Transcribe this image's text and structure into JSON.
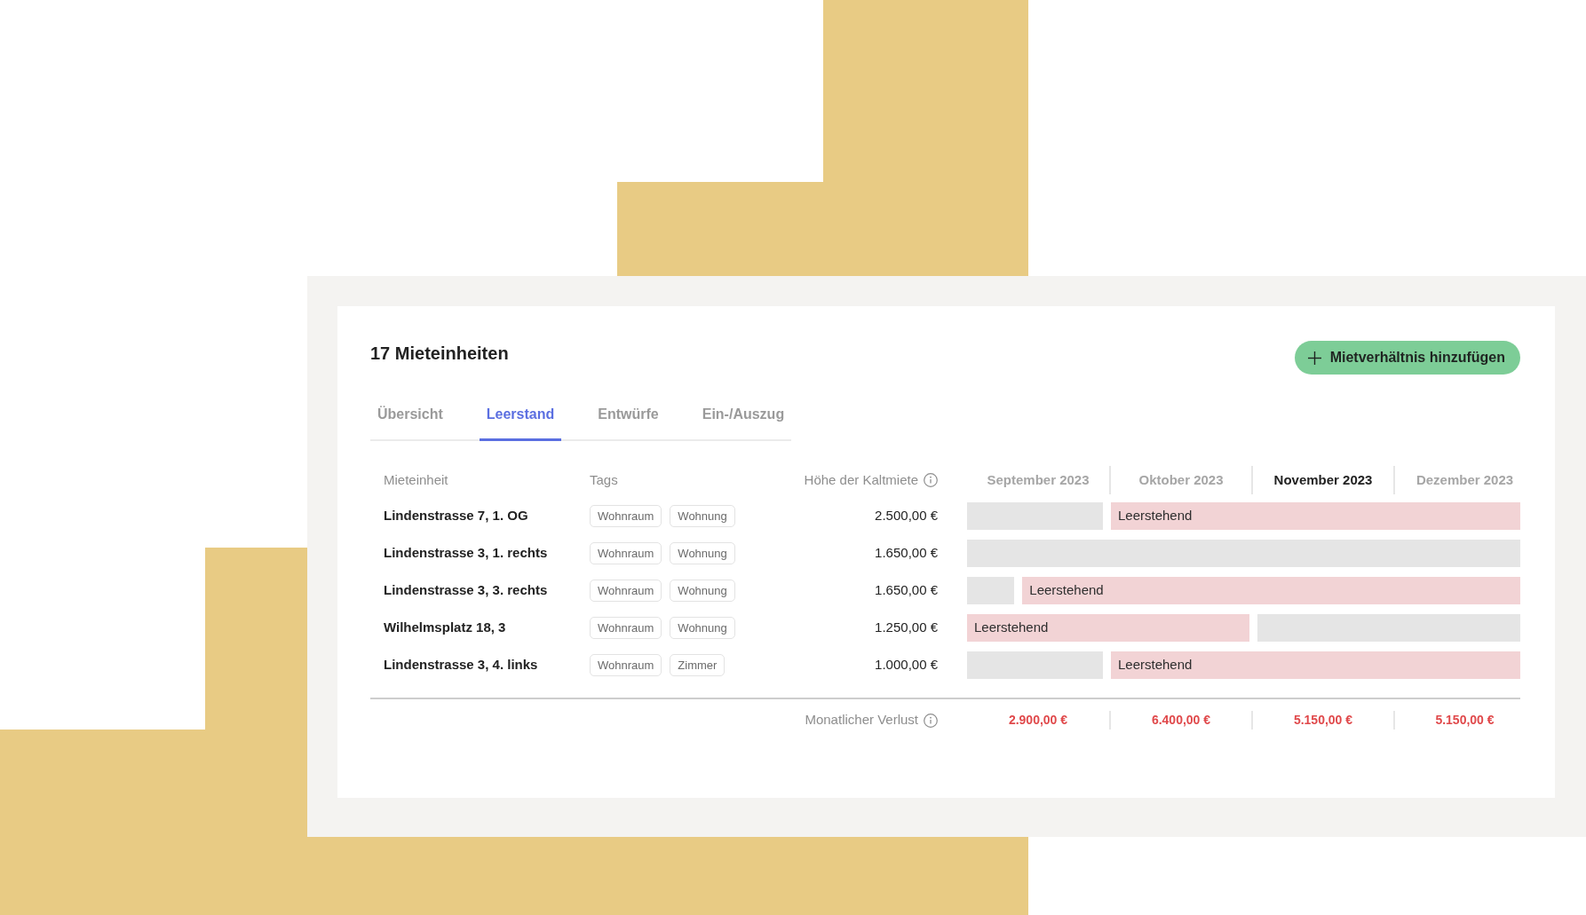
{
  "title": "17 Mieteinheiten",
  "add_button": {
    "label": "Mietverhältnis hinzufügen"
  },
  "tabs": [
    {
      "label": "Übersicht",
      "selected": false
    },
    {
      "label": "Leerstand",
      "selected": true
    },
    {
      "label": "Entwürfe",
      "selected": false
    },
    {
      "label": "Ein-/Auszug",
      "selected": false
    }
  ],
  "table": {
    "columns": [
      {
        "label": "Mieteinheit",
        "info": false
      },
      {
        "label": "Tags",
        "info": false
      },
      {
        "label": "Höhe der Kaltmiete",
        "info": true
      }
    ],
    "months": [
      {
        "label": "September 2023",
        "current": false
      },
      {
        "label": "Oktober 2023",
        "current": false
      },
      {
        "label": "November 2023",
        "current": true
      },
      {
        "label": "Dezember 2023",
        "current": false
      }
    ],
    "rows": [
      {
        "unit": "Lindenstrasse 7, 1. OG",
        "tags": [
          "Wohnraum",
          "Wohnung"
        ],
        "rent": "2.500,00 €",
        "vacancy": {
          "kind": "trailing",
          "label": "Leerstehend",
          "level": 0.74
        }
      },
      {
        "unit": "Lindenstrasse 3, 1. rechts",
        "tags": [
          "Wohnraum",
          "Wohnung"
        ],
        "rent": "1.650,00 €"
      },
      {
        "unit": "Lindenstrasse 3, 3. rechts",
        "tags": [
          "Wohnraum",
          "Wohnung"
        ],
        "rent": "1.650,00 €",
        "vacancy": {
          "kind": "trailing",
          "label": "Leerstehend",
          "level": 0.9
        }
      },
      {
        "unit": "Wilhelmsplatz 18, 3",
        "tags": [
          "Wohnraum",
          "Wohnung"
        ],
        "rent": "1.250,00 €",
        "vacancy": {
          "kind": "leading",
          "label": "Leerstehend",
          "level": 0.51
        }
      },
      {
        "unit": "Lindenstrasse 3, 4. links",
        "tags": [
          "Wohnraum",
          "Zimmer"
        ],
        "rent": "1.000,00 €",
        "vacancy": {
          "kind": "trailing",
          "label": "Leerstehend",
          "level": 0.74
        }
      }
    ],
    "footer": {
      "label": "Monatlicher Verlust",
      "info": true,
      "values": [
        "2.900,00 €",
        "6.400,00 €",
        "5.150,00 €",
        "5.150,00 €"
      ]
    }
  }
}
